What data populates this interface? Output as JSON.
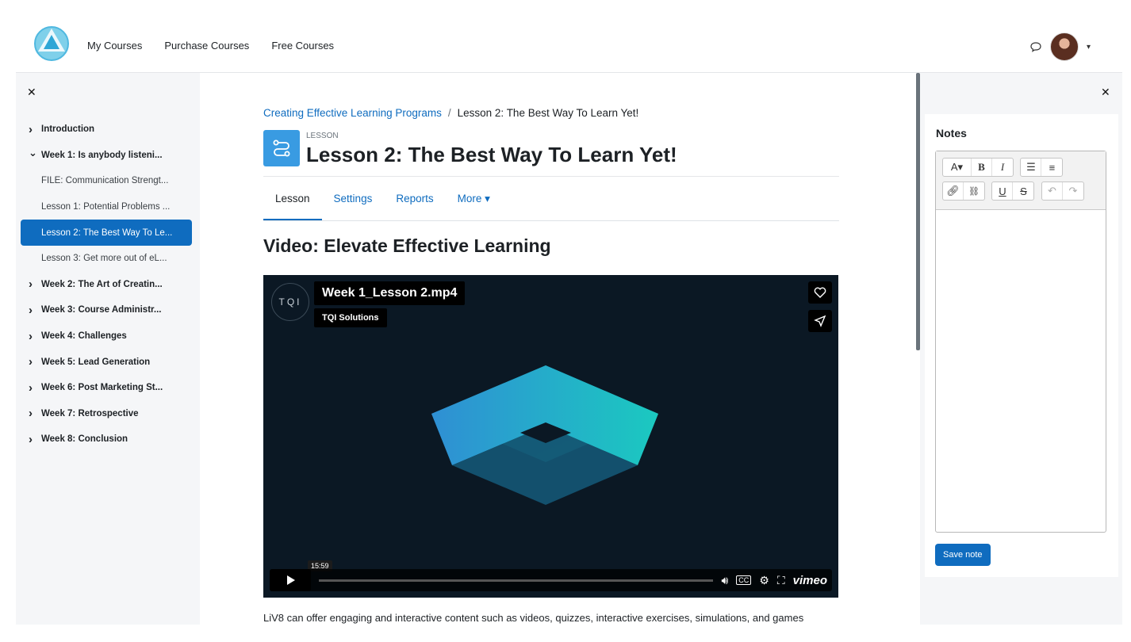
{
  "header": {
    "nav": [
      "My Courses",
      "Purchase Courses",
      "Free Courses"
    ],
    "icons": {
      "logo": "app-logo",
      "messages": "message-bubble-icon",
      "user_menu": "chevron-down-icon"
    }
  },
  "course_index": {
    "close_icon": "close-icon",
    "items": [
      {
        "label": "Introduction",
        "kind": "section",
        "state": "collapsed"
      },
      {
        "label": "Week 1: Is anybody listeni...",
        "kind": "section",
        "state": "expanded"
      },
      {
        "label": "FILE: Communication Strengt...",
        "kind": "activity"
      },
      {
        "label": "Lesson 1: Potential Problems ...",
        "kind": "activity"
      },
      {
        "label": "Lesson 2: The Best Way To Le...",
        "kind": "activity",
        "active": true
      },
      {
        "label": "Lesson 3: Get more out of eL...",
        "kind": "activity"
      },
      {
        "label": "Week 2: The Art of Creatin...",
        "kind": "section",
        "state": "collapsed"
      },
      {
        "label": "Week 3: Course Administr...",
        "kind": "section",
        "state": "collapsed"
      },
      {
        "label": "Week 4: Challenges",
        "kind": "section",
        "state": "collapsed"
      },
      {
        "label": "Week 5: Lead Generation",
        "kind": "section",
        "state": "collapsed"
      },
      {
        "label": "Week 6: Post Marketing St...",
        "kind": "section",
        "state": "collapsed"
      },
      {
        "label": "Week 7: Retrospective",
        "kind": "section",
        "state": "collapsed"
      },
      {
        "label": "Week 8: Conclusion",
        "kind": "section",
        "state": "collapsed"
      }
    ]
  },
  "main": {
    "breadcrumb": {
      "parent": "Creating Effective Learning Programs",
      "separator": "/",
      "current": "Lesson 2: The Best Way To Learn Yet!"
    },
    "kicker": "LESSON",
    "title": "Lesson 2: The Best Way To Learn Yet!",
    "tabs": [
      "Lesson",
      "Settings",
      "Reports",
      "More ▾"
    ],
    "active_tab": "Lesson",
    "section_heading": "Video: Elevate Effective Learning",
    "video": {
      "channel_badge": "TQI",
      "title": "Week 1_Lesson 2.mp4",
      "owner": "TQI Solutions",
      "time_tooltip": "15:59",
      "brand": "vimeo",
      "icons": [
        "heart-icon",
        "share-icon",
        "play-icon",
        "volume-icon",
        "captions-icon",
        "settings-icon",
        "fullscreen-icon"
      ]
    },
    "body_text": "LiV8 can offer engaging and interactive content such as videos, quizzes, interactive exercises, simulations, and games"
  },
  "notes": {
    "close_icon": "close-icon",
    "heading": "Notes",
    "editor_value": "",
    "save_label": "Save note"
  },
  "colors": {
    "primary": "#0f6cbf",
    "lesson_icon": "#399be2",
    "drawer_bg": "#f5f6f8",
    "video_bg": "#0b1824"
  }
}
